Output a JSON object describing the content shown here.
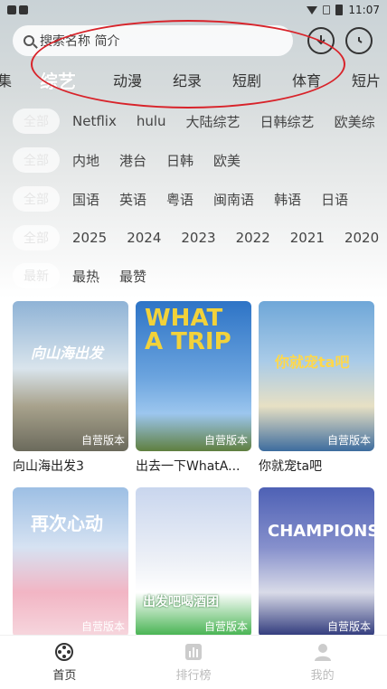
{
  "status": {
    "time": "11:07"
  },
  "search": {
    "placeholder": "搜索名称 简介"
  },
  "categories": [
    {
      "label": "集",
      "active": false
    },
    {
      "label": "综艺",
      "active": true
    },
    {
      "label": "动漫",
      "active": false
    },
    {
      "label": "纪录",
      "active": false
    },
    {
      "label": "短剧",
      "active": false
    },
    {
      "label": "体育",
      "active": false
    },
    {
      "label": "短片",
      "active": false
    }
  ],
  "filters": {
    "row1": {
      "all": "全部",
      "options": [
        "Netflix",
        "hulu",
        "大陆综艺",
        "日韩综艺",
        "欧美综"
      ]
    },
    "row2": {
      "all": "全部",
      "options": [
        "内地",
        "港台",
        "日韩",
        "欧美"
      ]
    },
    "row3": {
      "all": "全部",
      "options": [
        "国语",
        "英语",
        "粤语",
        "闽南语",
        "韩语",
        "日语"
      ]
    },
    "row4": {
      "all": "全部",
      "options": [
        "2025",
        "2024",
        "2023",
        "2022",
        "2021",
        "2020"
      ]
    },
    "row5": {
      "all": "最新",
      "options": [
        "最热",
        "最赞"
      ]
    }
  },
  "cards": [
    {
      "title": "向山海出发3",
      "badge": "自营版本",
      "poster_text": "向山海出发",
      "colors": [
        "#8fb3d6",
        "#d9e4ec",
        "#6b6a5c"
      ]
    },
    {
      "title": "出去一下WhatA...",
      "badge": "自营版本",
      "poster_text": "WHAT A TRIP",
      "colors": [
        "#2e74c6",
        "#6aa3de",
        "#e8c62f"
      ]
    },
    {
      "title": "你就宠ta吧",
      "badge": "自营版本",
      "poster_text": "你就宠ta吧",
      "colors": [
        "#6fa7d8",
        "#e7e0c4",
        "#3d6c9e"
      ]
    },
    {
      "title": "",
      "badge": "自营版本",
      "poster_text": "再次心动",
      "colors": [
        "#9dbfe4",
        "#f2b5c4",
        "#f6d7de"
      ]
    },
    {
      "title": "",
      "badge": "自营版本",
      "poster_text": "出发吧喝酒团",
      "colors": [
        "#c9d6ee",
        "#ffffff",
        "#3fb04a"
      ]
    },
    {
      "title": "",
      "badge": "自营版本",
      "poster_text": "CHAMPIONS",
      "colors": [
        "#4e61b5",
        "#d9dbe8",
        "#2a3478"
      ]
    }
  ],
  "nav": [
    {
      "label": "首页",
      "icon": "film-reel-icon",
      "active": true
    },
    {
      "label": "排行榜",
      "icon": "chart-icon",
      "active": false
    },
    {
      "label": "我的",
      "icon": "profile-icon",
      "active": false
    }
  ]
}
